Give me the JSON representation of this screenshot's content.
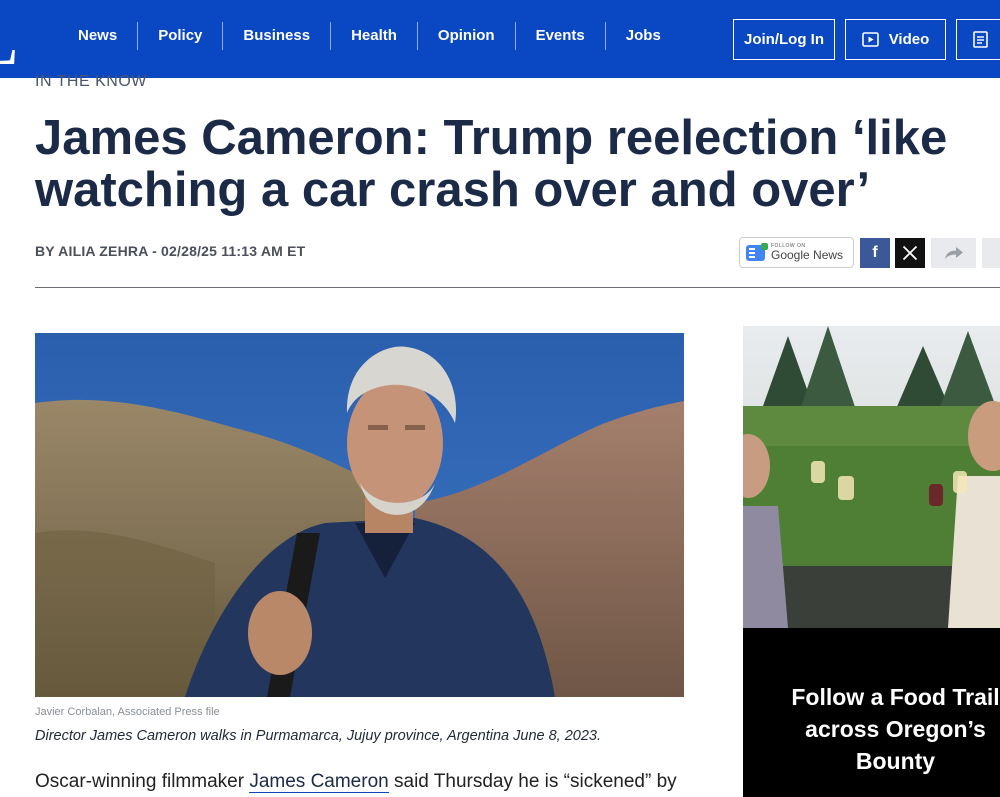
{
  "brand": {
    "logo_text": "L"
  },
  "nav": {
    "items": [
      {
        "label": "News"
      },
      {
        "label": "Policy"
      },
      {
        "label": "Business"
      },
      {
        "label": "Health"
      },
      {
        "label": "Opinion"
      },
      {
        "label": "Events"
      },
      {
        "label": "Jobs"
      }
    ],
    "join_label": "Join/Log In",
    "video_label": "Video"
  },
  "article": {
    "kicker": "IN THE KNOW",
    "headline_line1": "James Cameron: Trump reelection ‘like",
    "headline_line2": "watching a car crash over and over’",
    "byline": "BY AILIA ZEHRA - 02/28/25 11:13 AM ET",
    "photo_credit": "Javier Corbalan, Associated Press file",
    "photo_caption": "Director James Cameron walks in Purmamarca, Jujuy province, Argentina June 8, 2023.",
    "body_start": "Oscar-winning filmmaker ",
    "body_link": "James Cameron",
    "body_end": " said Thursday he is “sickened” by"
  },
  "share": {
    "google_news_small": "FOLLOW ON",
    "google_news_label": "Google News",
    "facebook_glyph": "f",
    "x_glyph": "X"
  },
  "ad": {
    "title_line1": "Follow a Food Trail",
    "title_line2": "across Oregon’s",
    "title_line3": "Bounty"
  },
  "colors": {
    "nav_bg": "#0a47c2",
    "headline": "#1b2a47",
    "facebook": "#3b5998"
  }
}
